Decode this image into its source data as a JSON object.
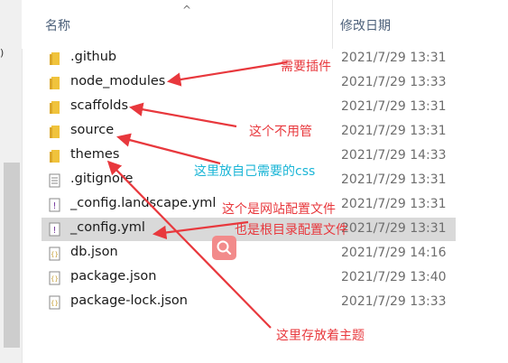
{
  "header": {
    "name_column": "名称",
    "date_column": "修改日期",
    "sort_glyph": "^"
  },
  "left_strip": {
    "edge_text": ")"
  },
  "files": [
    {
      "name": ".github",
      "date": "2021/7/29 13:31",
      "type": "folder"
    },
    {
      "name": "node_modules",
      "date": "2021/7/29 13:33",
      "type": "folder"
    },
    {
      "name": "scaffolds",
      "date": "2021/7/29 13:31",
      "type": "folder"
    },
    {
      "name": "source",
      "date": "2021/7/29 13:31",
      "type": "folder"
    },
    {
      "name": "themes",
      "date": "2021/7/29 14:33",
      "type": "folder"
    },
    {
      "name": ".gitignore",
      "date": "2021/7/29 13:31",
      "type": "text"
    },
    {
      "name": "_config.landscape.yml",
      "date": "2021/7/29 13:31",
      "type": "yml"
    },
    {
      "name": "_config.yml",
      "date": "2021/7/29 13:31",
      "type": "yml",
      "selected": true
    },
    {
      "name": "db.json",
      "date": "2021/7/29 14:16",
      "type": "json"
    },
    {
      "name": "package.json",
      "date": "2021/7/29 13:40",
      "type": "json"
    },
    {
      "name": "package-lock.json",
      "date": "2021/7/29 13:33",
      "type": "json"
    }
  ],
  "annotations": {
    "node_modules_note": "需要插件",
    "scaffolds_note": "这个不用管",
    "source_note": "这里放自己需要的css",
    "config_note_line1": "这个是网站配置文件",
    "config_note_line2": "也是根目录配置文件",
    "themes_note": "这里存放着主题"
  },
  "colors": {
    "annotation_red": "#e8383d",
    "annotation_cyan": "#1ab5d6",
    "folder_yellow": "#f0c33c",
    "selection_gray": "#d9d9d9",
    "date_gray": "#6d6d6d"
  },
  "icons": {
    "folder": "folder-icon",
    "text": "text-file-icon",
    "yml": "yml-file-icon",
    "json": "json-file-icon",
    "search": "search-icon"
  }
}
